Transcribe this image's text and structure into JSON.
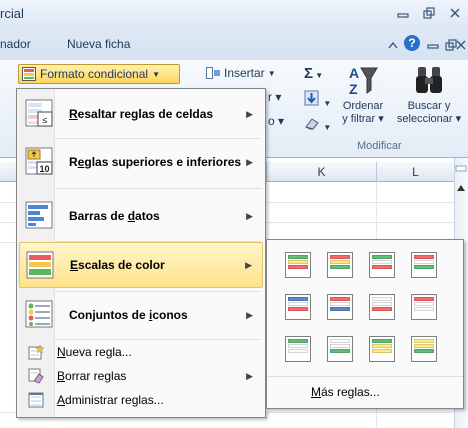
{
  "window": {
    "title": "rcial",
    "controls": {
      "minimize": "▭",
      "restore": "🗗",
      "close": "✕"
    }
  },
  "tabs": {
    "items": [
      {
        "label": "nador"
      },
      {
        "label": "Nueva ficha"
      }
    ],
    "right_controls": {
      "help": "?",
      "minimize": "▭",
      "restore": "🗗",
      "close": "✕"
    }
  },
  "ribbon": {
    "conditional_format_label": "Formato condicional",
    "insert_label": "Insertar",
    "sort_filter_label_1": "Ordenar",
    "sort_filter_label_2": "y filtrar",
    "find_select_label_1": "Buscar y",
    "find_select_label_2": "seleccionar",
    "group_label": "Modificar"
  },
  "sheet": {
    "columns": [
      {
        "label": "K"
      },
      {
        "label": "L"
      }
    ]
  },
  "menu": {
    "highlight_rules": "Resaltar reglas de celdas",
    "top_bottom_rules": "Reglas superiores e inferiores",
    "data_bars": "Barras de datos",
    "color_scales": "Escalas de color",
    "icon_sets": "Conjuntos de iconos",
    "new_rule": "Nueva regla...",
    "clear_rules": "Borrar reglas",
    "manage_rules": "Administrar reglas..."
  },
  "submenu": {
    "more_rules": "Más reglas...",
    "swatches": [
      [
        "#63be7b",
        "#ffeb84",
        "#f8696b"
      ],
      [
        "#f8696b",
        "#ffeb84",
        "#63be7b"
      ],
      [
        "#63be7b",
        "#fcfcff",
        "#f8696b"
      ],
      [
        "#f8696b",
        "#fcfcff",
        "#63be7b"
      ],
      [
        "#5a8ac6",
        "#fcfcff",
        "#f8696b"
      ],
      [
        "#f8696b",
        "#fcfcff",
        "#5a8ac6"
      ],
      [
        "#fcfcff",
        "#fcfcff",
        "#f8696b"
      ],
      [
        "#f8696b",
        "#fcfcff",
        "#fcfcff"
      ],
      [
        "#63be7b",
        "#fcfcff",
        "#fcfcff"
      ],
      [
        "#fcfcff",
        "#fcfcff",
        "#63be7b"
      ],
      [
        "#63be7b",
        "#ffeb84",
        "#ffeb84"
      ],
      [
        "#ffeb84",
        "#ffeb84",
        "#63be7b"
      ]
    ]
  }
}
